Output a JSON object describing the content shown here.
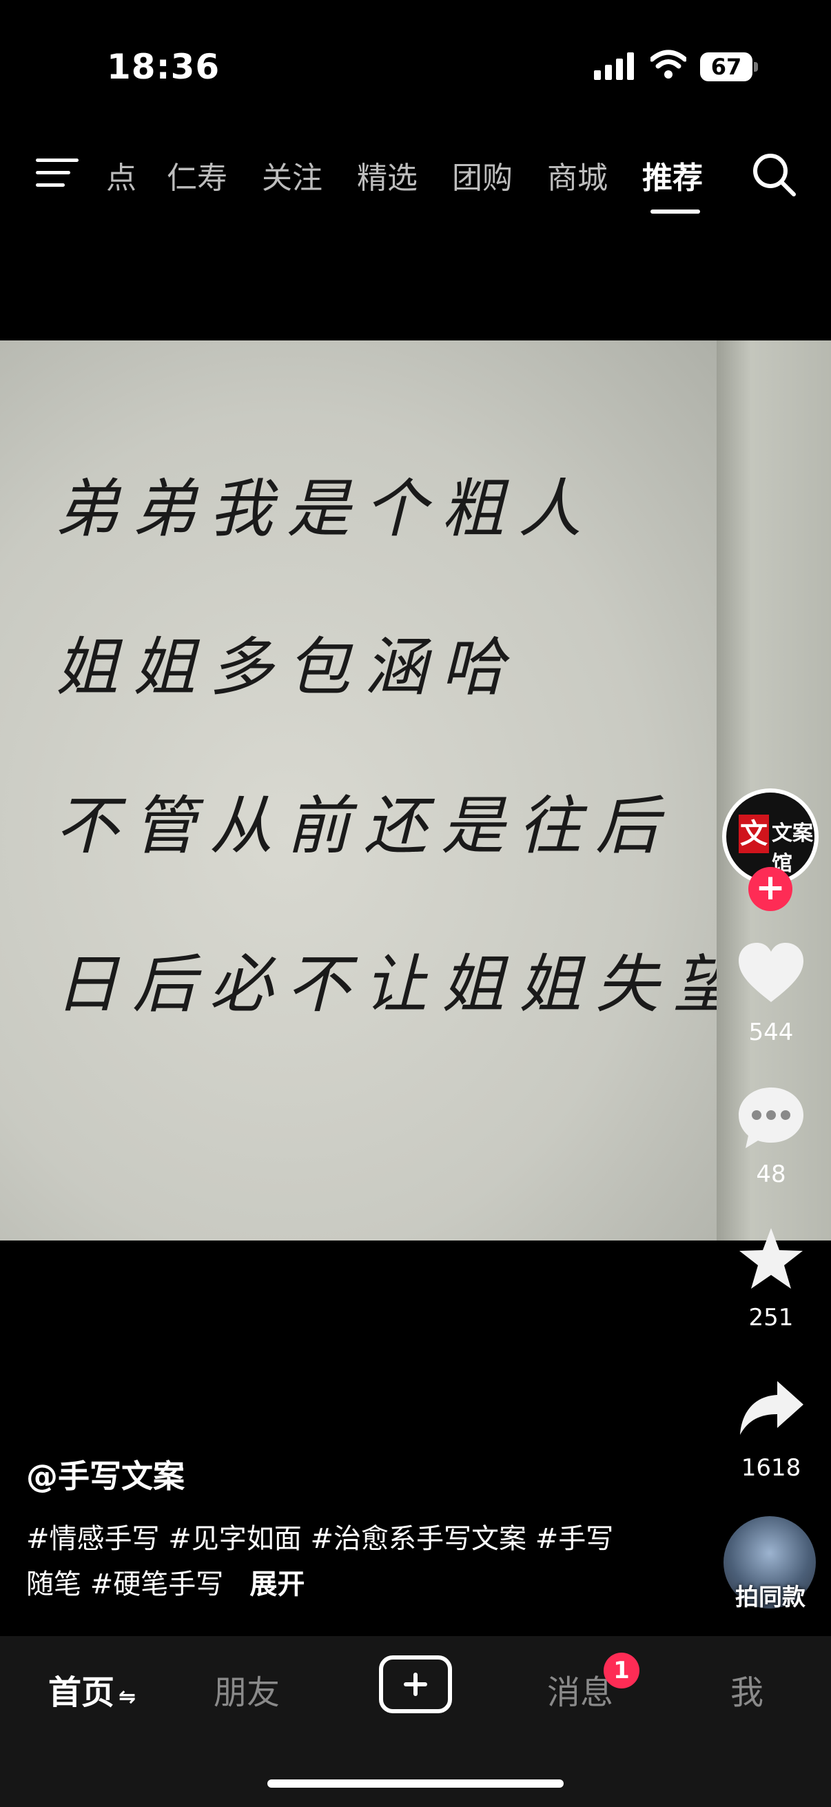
{
  "status_bar": {
    "time": "18:36",
    "battery": "67"
  },
  "top_nav": {
    "tabs": [
      "点",
      "仁寿",
      "关注",
      "精选",
      "团购",
      "商城",
      "推荐"
    ],
    "active_tab": "推荐"
  },
  "video": {
    "handwriting": [
      "弟弟我是个粗人",
      "姐姐多包涵哈",
      "不管从前还是往后",
      "日后必不让姐姐失望"
    ]
  },
  "creator": {
    "avatar_text": "文案馆",
    "follow": "+"
  },
  "actions": {
    "likes": "544",
    "comments": "48",
    "favorites": "251",
    "shares": "1618"
  },
  "post": {
    "author": "@手写文案",
    "description": "#情感手写 #见字如面 #治愈系手写文案 #手写随笔 #硬笔手写",
    "expand": "展开",
    "same_style": "拍同款"
  },
  "bottom_tabs": {
    "home": "首页",
    "friends": "朋友",
    "messages": "消息",
    "messages_badge": "1",
    "me": "我"
  },
  "colors": {
    "accent": "#fe2c55",
    "tabbar_bg": "#161616"
  },
  "icons": [
    "menu-icon",
    "search-icon",
    "heart-icon",
    "comment-icon",
    "star-icon",
    "share-icon",
    "plus-icon"
  ]
}
